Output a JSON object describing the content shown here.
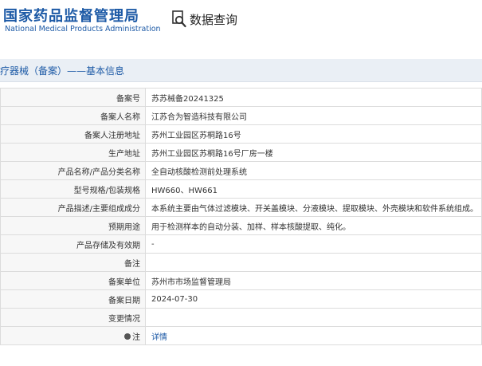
{
  "header": {
    "logo_cn": "国家药品监督管理局",
    "logo_en": "National Medical Products Administration",
    "search_label": "数据查询",
    "search_icon": "search-icon"
  },
  "section": {
    "title": "疗器械（备案）——基本信息"
  },
  "rows": [
    {
      "label": "备案号",
      "value": "苏苏械备20241325"
    },
    {
      "label": "备案人名称",
      "value": "江苏合为智造科技有限公司"
    },
    {
      "label": "备案人注册地址",
      "value": "苏州工业园区苏桐路16号"
    },
    {
      "label": "生产地址",
      "value": "苏州工业园区苏桐路16号厂房一楼"
    },
    {
      "label": "产品名称/产品分类名称",
      "value": "全自动核酸检测前处理系统"
    },
    {
      "label": "型号规格/包装规格",
      "value": "HW660、HW661"
    },
    {
      "label": "产品描述/主要组成成分",
      "value": "本系统主要由气体过滤模块、开关盖模块、分液模块、提取模块、外壳模块和软件系统组成。"
    },
    {
      "label": "预期用途",
      "value": "用于检测样本的自动分装、加样、样本核酸提取、纯化。"
    },
    {
      "label": "产品存储及有效期",
      "value": "-"
    },
    {
      "label": "备注",
      "value": ""
    },
    {
      "label": "备案单位",
      "value": "苏州市市场监督管理局"
    },
    {
      "label": "备案日期",
      "value": "2024-07-30"
    },
    {
      "label": "变更情况",
      "value": ""
    }
  ],
  "note_row": {
    "label": "注",
    "link": "详情",
    "icon": "lightbulb-icon"
  },
  "colors": {
    "brand_blue": "#1d5aa6",
    "title_bar_bg": "#eaeff5",
    "border": "#dcdcdc",
    "label_bg": "#f7f7f7"
  }
}
